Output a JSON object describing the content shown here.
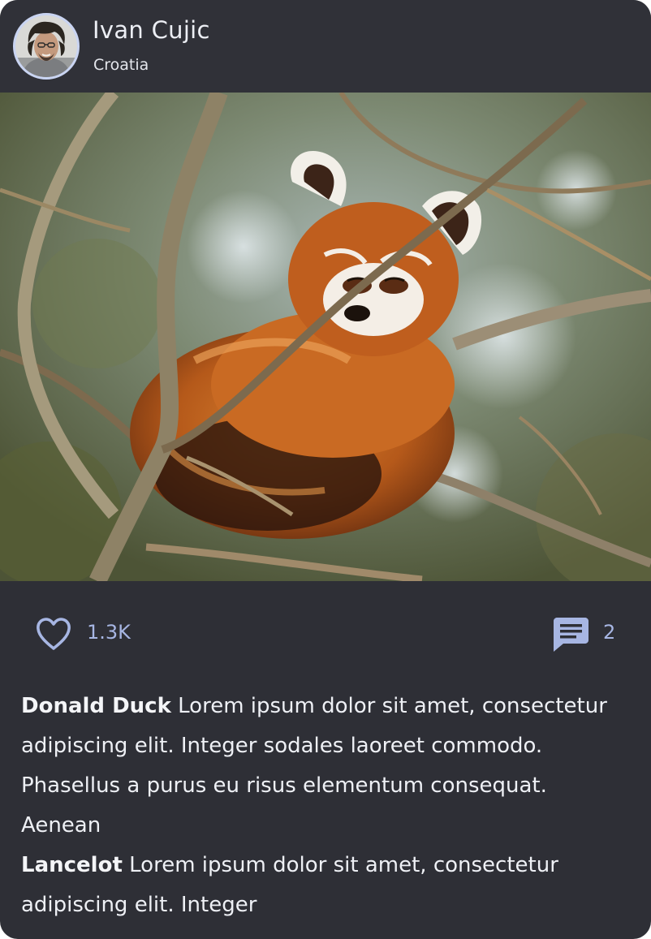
{
  "post": {
    "author": {
      "name": "Ivan Cujic",
      "location": "Croatia"
    },
    "photo": {
      "subject": "red-panda-photo"
    },
    "likes": {
      "icon": "heart-icon",
      "count": "1.3K"
    },
    "comments_count": {
      "icon": "comment-icon",
      "count": "2"
    },
    "comments": [
      {
        "author": "Donald Duck",
        "text": "Lorem ipsum dolor sit amet, consectetur adipiscing elit. Integer sodales laoreet commodo. Phasellus a purus eu risus elementum consequat. Aenean"
      },
      {
        "author": "Lancelot",
        "text": "Lorem ipsum dolor sit amet, consectetur adipiscing elit. Integer"
      }
    ]
  },
  "colors": {
    "card_background": "#2e2f36",
    "header_background": "#303138",
    "accent": "#a7b6e3",
    "text": "#eef0f5"
  }
}
